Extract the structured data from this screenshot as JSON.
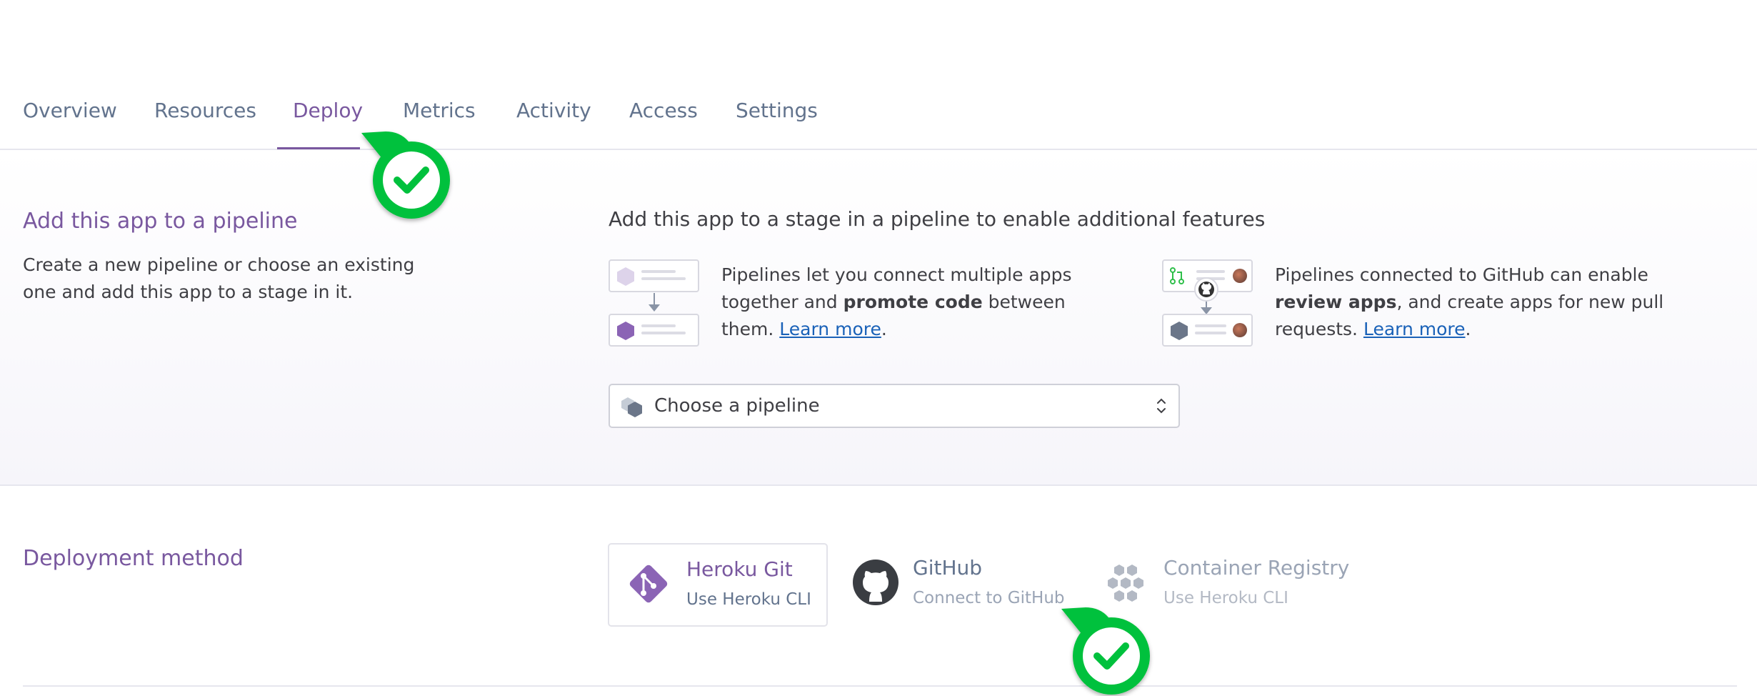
{
  "tabs": [
    {
      "label": "Overview"
    },
    {
      "label": "Resources"
    },
    {
      "label": "Deploy",
      "active": true
    },
    {
      "label": "Metrics"
    },
    {
      "label": "Activity"
    },
    {
      "label": "Access"
    },
    {
      "label": "Settings"
    }
  ],
  "pipeline": {
    "title": "Add this app to a pipeline",
    "description": "Create a new pipeline or choose an existing one and add this app to a stage in it.",
    "headline": "Add this app to a stage in a pipeline to enable additional features",
    "feature1": {
      "text_before": "Pipelines let you connect multiple apps together and ",
      "bold": "promote code",
      "text_after": " between them. ",
      "link": "Learn more",
      "end": "."
    },
    "feature2": {
      "text_before": "Pipelines connected to GitHub can enable ",
      "bold": "review apps",
      "text_after": ", and create apps for new pull requests. ",
      "link": "Learn more",
      "end": "."
    },
    "select_label": "Choose a pipeline"
  },
  "deployment": {
    "title": "Deployment method",
    "methods": [
      {
        "title": "Heroku Git",
        "subtitle": "Use Heroku CLI",
        "icon": "heroku-git-icon",
        "selected": true
      },
      {
        "title": "GitHub",
        "subtitle": "Connect to GitHub",
        "icon": "github-icon"
      },
      {
        "title": "Container Registry",
        "subtitle": "Use Heroku CLI",
        "icon": "container-registry-icon"
      }
    ]
  },
  "colors": {
    "accent": "#79589f",
    "link": "#1a62b8",
    "marker": "#00c13c",
    "muted": "#62738d"
  }
}
